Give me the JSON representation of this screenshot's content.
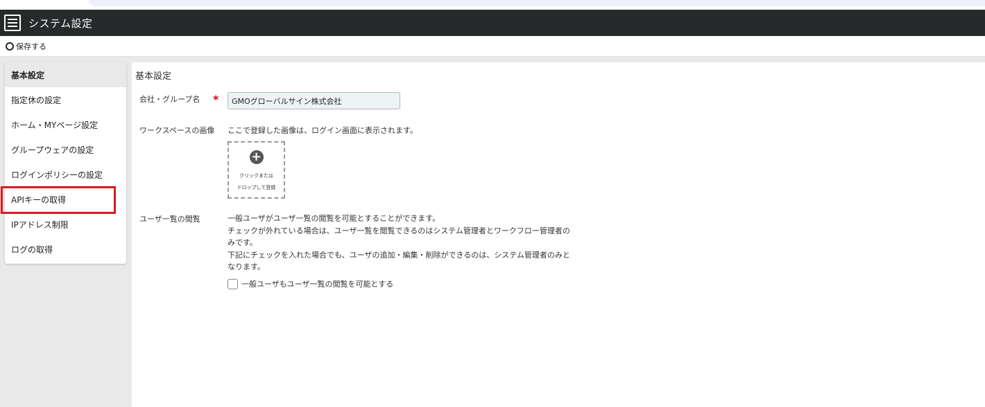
{
  "header": {
    "title": "システム設定",
    "menu_icon": "hamburger-icon"
  },
  "toolbar": {
    "save_label": "保存する"
  },
  "sidebar": {
    "items": [
      {
        "label": "基本設定",
        "active": true
      },
      {
        "label": "指定休の設定"
      },
      {
        "label": "ホーム・MYページ設定"
      },
      {
        "label": "グループウェアの設定"
      },
      {
        "label": "ログインポリシーの設定"
      },
      {
        "label": "APIキーの取得",
        "highlighted": true
      },
      {
        "label": "IPアドレス制限"
      },
      {
        "label": "ログの取得"
      }
    ]
  },
  "content": {
    "section_title": "基本設定",
    "company": {
      "label": "会社・グループ名",
      "required_mark": "*",
      "value": "GMOグローバルサイン株式会社"
    },
    "workspace_image": {
      "label": "ワークスペースの画像",
      "hint": "ここで登録した画像は、ログイン画面に表示されます。",
      "dropzone_line1": "クリックまたは",
      "dropzone_line2": "ドロップして登録"
    },
    "user_list": {
      "label": "ユーザ一覧の閲覧",
      "desc_line1": "一般ユーザがユーザ一覧の閲覧を可能とすることができます。",
      "desc_line2": "チェックが外れている場合は、ユーザ一覧を閲覧できるのはシステム管理者とワークフロー管理者の",
      "desc_line3": "みです。",
      "desc_line4": "下記にチェックを入れた場合でも、ユーザの追加・編集・削除ができるのは、システム管理者のみと",
      "desc_line5": "なります。",
      "checkbox_label": "一般ユーザもユーザ一覧の閲覧を可能とする",
      "checked": false
    }
  },
  "colors": {
    "topbar": "#262a2b",
    "highlight": "#e0161f",
    "required": "#d0021b"
  }
}
